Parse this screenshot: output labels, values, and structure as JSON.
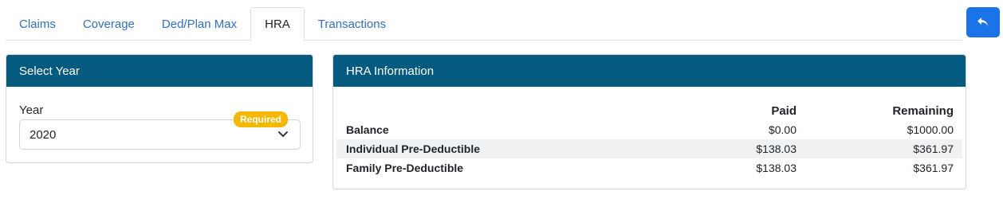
{
  "tabs": [
    {
      "label": "Claims",
      "active": false
    },
    {
      "label": "Coverage",
      "active": false
    },
    {
      "label": "Ded/Plan Max",
      "active": false
    },
    {
      "label": "HRA",
      "active": true
    },
    {
      "label": "Transactions",
      "active": false
    }
  ],
  "back_button": {
    "icon": "reply-arrow-icon",
    "color": "#1a73e8"
  },
  "select_year": {
    "header": "Select Year",
    "field_label": "Year",
    "required_badge": "Required",
    "selected_value": "2020"
  },
  "hra_info": {
    "header": "HRA Information",
    "columns": [
      "",
      "Paid",
      "Remaining"
    ],
    "rows": [
      {
        "label": "Balance",
        "paid": "$0.00",
        "remaining": "$1000.00"
      },
      {
        "label": "Individual Pre-Deductible",
        "paid": "$138.03",
        "remaining": "$361.97"
      },
      {
        "label": "Family Pre-Deductible",
        "paid": "$138.03",
        "remaining": "$361.97"
      }
    ]
  },
  "colors": {
    "header_bg": "#055a80",
    "link": "#2f6fc9",
    "badge": "#f5b800"
  }
}
